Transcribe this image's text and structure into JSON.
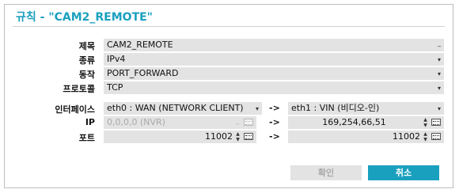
{
  "dialog": {
    "title": "규칙 - \"CAM2_REMOTE\"",
    "accent": "#1aa0bf"
  },
  "fields": {
    "name": {
      "label": "제목",
      "value": "CAM2_REMOTE",
      "suffix": "_"
    },
    "type": {
      "label": "종류",
      "value": "IPv4"
    },
    "action": {
      "label": "동작",
      "value": "PORT_FORWARD"
    },
    "protocol": {
      "label": "프로토콜",
      "value": "TCP"
    }
  },
  "interface": {
    "label": "인터페이스",
    "source": "eth0 : WAN (NETWORK CLIENT)",
    "target": "eth1 : VIN (비디오-인)"
  },
  "ip": {
    "label": "IP",
    "source": "0,0,0,0 (NVR)",
    "target": "169,254,66,51"
  },
  "port": {
    "label": "포트",
    "source": "11002",
    "target": "11002"
  },
  "arrow": "->",
  "buttons": {
    "confirm": "확인",
    "cancel": "취소"
  },
  "icons": {
    "dropdown": "▾",
    "spin_up": "▲",
    "spin_down": "▼"
  }
}
